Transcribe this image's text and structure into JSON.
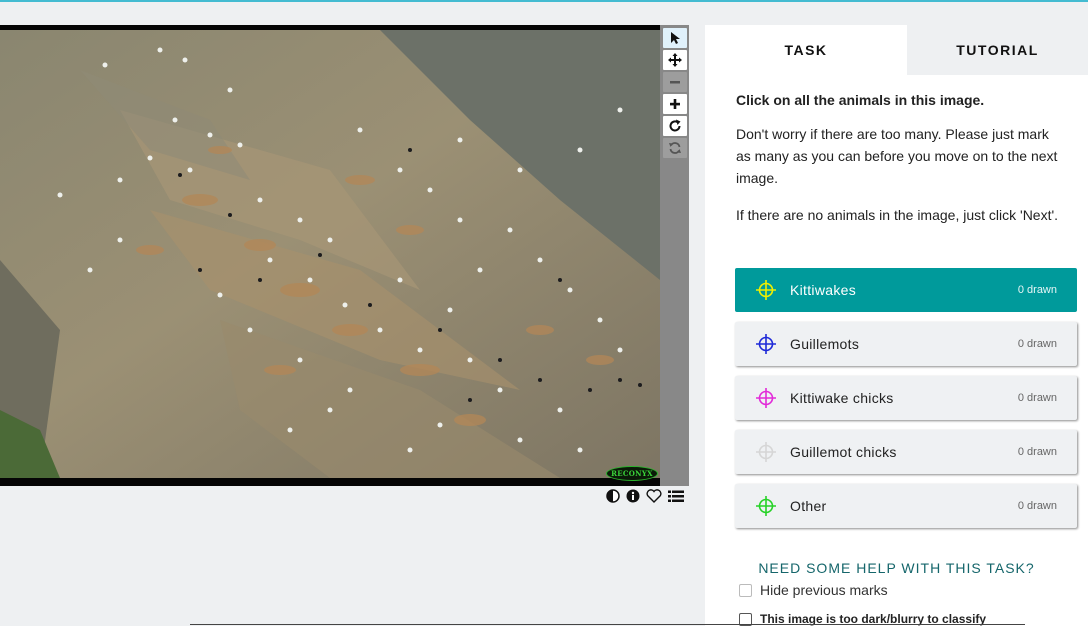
{
  "colors": {
    "accent_top": "#43bbd1",
    "selected_choice": "#009a9b",
    "help_link": "#15666b"
  },
  "toolbar": {
    "tools": [
      {
        "name": "pointer-tool",
        "icon": "cursor-arrow-icon",
        "state": "active"
      },
      {
        "name": "pan-tool",
        "icon": "move-arrows-icon",
        "state": "normal"
      },
      {
        "name": "zoom-out-tool",
        "icon": "minus-icon",
        "state": "disabled"
      },
      {
        "name": "zoom-in-tool",
        "icon": "plus-icon",
        "state": "normal"
      },
      {
        "name": "rotate-tool",
        "icon": "rotate-icon",
        "state": "normal"
      },
      {
        "name": "reset-tool",
        "icon": "refresh-icon",
        "state": "disabled"
      }
    ]
  },
  "image": {
    "watermark": "RECONYX"
  },
  "image_actions": [
    "contrast-icon",
    "info-icon",
    "heart-icon",
    "list-icon"
  ],
  "tabs": [
    {
      "label": "TASK",
      "active": true
    },
    {
      "label": "TUTORIAL",
      "active": false
    }
  ],
  "task": {
    "instruction": "Click on all the animals in this image.",
    "paragraphs": [
      "Don't worry if there are too many. Please just mark as many as you can before you move on to the next image.",
      "If there are no animals in the image, just click 'Next'."
    ],
    "choices": [
      {
        "label": "Kittiwakes",
        "count": "0 drawn",
        "color": "#f0f000",
        "selected": true
      },
      {
        "label": "Guillemots",
        "count": "0 drawn",
        "color": "#1f2ad8",
        "selected": false
      },
      {
        "label": "Kittiwake chicks",
        "count": "0 drawn",
        "color": "#e22bd8",
        "selected": false
      },
      {
        "label": "Guillemot chicks",
        "count": "0 drawn",
        "color": "#d6d6d6",
        "selected": false
      },
      {
        "label": "Other",
        "count": "0 drawn",
        "color": "#27d227",
        "selected": false
      }
    ],
    "help_link": "NEED SOME HELP WITH THIS TASK?",
    "hide_marks_label": "Hide previous marks",
    "too_dark_label": "This image is too dark/blurry to classify"
  }
}
